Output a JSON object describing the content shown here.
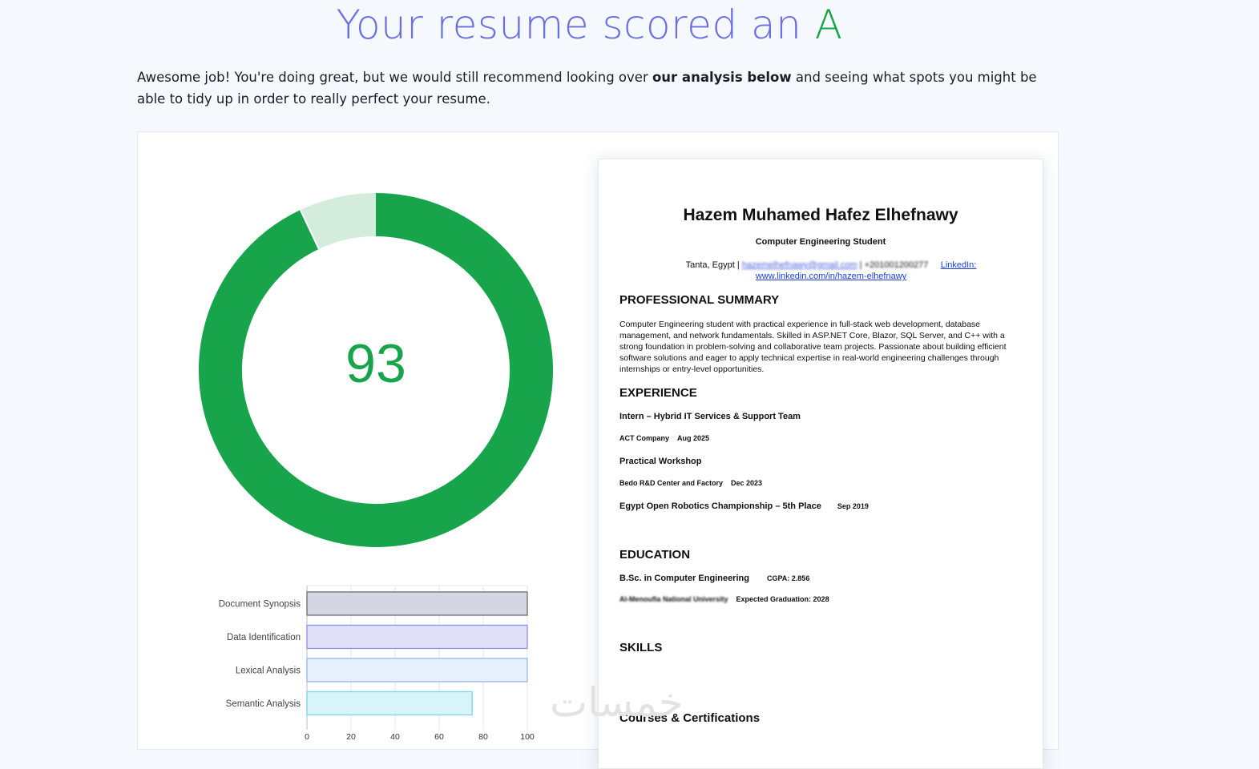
{
  "header": {
    "headline_prefix": "Your resume scored an ",
    "grade": "A",
    "intro_part1": "Awesome job! You're doing great, but we would still recommend looking over ",
    "intro_bold": "our analysis below",
    "intro_part2": " and seeing what spots you might be able to tidy up in order to really perfect your resume."
  },
  "score": {
    "value": "93",
    "percent": 93,
    "color_fill": "#17a44a",
    "color_rest": "#d4ecdc"
  },
  "chart_data": {
    "type": "bar",
    "orientation": "horizontal",
    "categories": [
      "Document Synopsis",
      "Data Identification",
      "Lexical Analysis",
      "Semantic Analysis"
    ],
    "values": [
      100,
      100,
      100,
      75
    ],
    "xlim": [
      0,
      100
    ],
    "ticks": [
      "0",
      "20",
      "40",
      "60",
      "80",
      "100"
    ],
    "colors": [
      "#d6d6e2",
      "#e0e1f8",
      "#e6effc",
      "#d8f4fb"
    ],
    "border_colors": [
      "#6b6b7a",
      "#8a8fe8",
      "#9ab5ec",
      "#7cd3ec"
    ],
    "grid": true
  },
  "resume": {
    "name": "Hazem Muhamed Hafez Elhefnawy",
    "title": "Computer Engineering Student",
    "location": "Tanta, Egypt | ",
    "email": "hazemelhefnawy@gmail.com",
    "phone": " | +201001200277",
    "linkedin_label": "LinkedIn:",
    "linkedin_url": "www.linkedin.com/in/hazem-elhefnawy",
    "summary_heading": "PROFESSIONAL SUMMARY",
    "summary": "Computer Engineering student with practical experience in full-stack web development, database management, and network fundamentals. Skilled in ASP.NET Core, Blazor, SQL Server, and C++ with a strong foundation in problem-solving and collaborative team projects. Passionate about building efficient software solutions and eager to apply technical expertise in real-world engineering challenges through internships or entry-level opportunities.",
    "experience_heading": "EXPERIENCE",
    "exp1_title": "Intern – Hybrid IT Services & Support Team",
    "exp1_company": "ACT Company",
    "exp1_date": "Aug 2025",
    "exp2_title": "Practical Workshop",
    "exp2_company": "Bedo R&D Center and Factory",
    "exp2_date": "Dec 2023",
    "exp3_title": "Egypt Open Robotics Championship – 5th Place",
    "exp3_date": "Sep 2019",
    "education_heading": "EDUCATION",
    "edu_degree": "B.Sc. in Computer Engineering",
    "edu_gpa": "CGPA: 2.856",
    "edu_university": "Al-Menoufia National University",
    "edu_graduation": "Expected Graduation: 2028",
    "skills_heading": "SKILLS",
    "courses_heading": "Courses & Certifications"
  },
  "watermark": "خمسات"
}
